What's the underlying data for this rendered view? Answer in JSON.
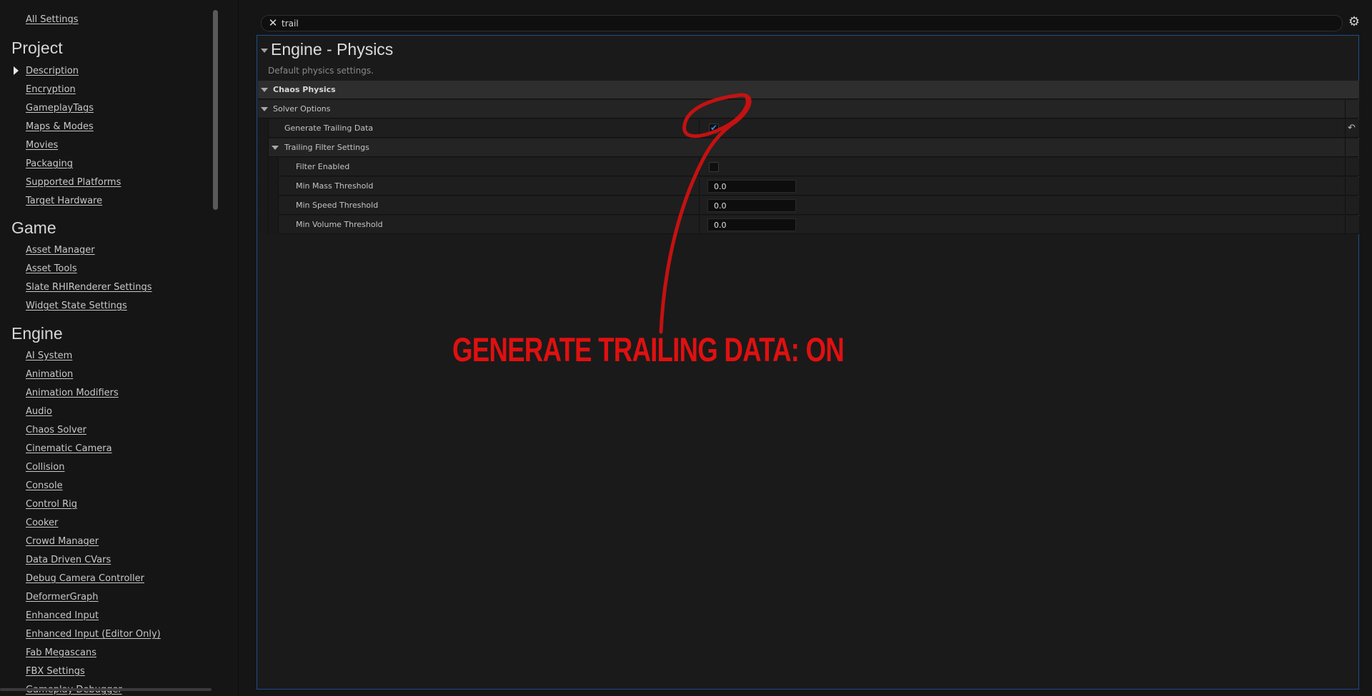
{
  "sidebar": {
    "all_settings": "All Settings",
    "sections": [
      {
        "heading": "Project",
        "items": [
          "Description",
          "Encryption",
          "GameplayTags",
          "Maps & Modes",
          "Movies",
          "Packaging",
          "Supported Platforms",
          "Target Hardware"
        ]
      },
      {
        "heading": "Game",
        "items": [
          "Asset Manager",
          "Asset Tools",
          "Slate RHIRenderer Settings",
          "Widget State Settings"
        ]
      },
      {
        "heading": "Engine",
        "items": [
          "AI System",
          "Animation",
          "Animation Modifiers",
          "Audio",
          "Chaos Solver",
          "Cinematic Camera",
          "Collision",
          "Console",
          "Control Rig",
          "Cooker",
          "Crowd Manager",
          "Data Driven CVars",
          "Debug Camera Controller",
          "DeformerGraph",
          "Enhanced Input",
          "Enhanced Input (Editor Only)",
          "Fab Megascans",
          "FBX Settings",
          "Gameplay Debugger"
        ]
      }
    ]
  },
  "search": {
    "value": "trail",
    "clear_icon": "close-icon"
  },
  "settings_icon": "gear-icon",
  "panel": {
    "title": "Engine - Physics",
    "description": "Default physics settings.",
    "category": "Chaos Physics",
    "subcategory": "Solver Options",
    "generate_trailing_data": {
      "label": "Generate Trailing Data",
      "checked": true
    },
    "trailing_filter_group": "Trailing Filter Settings",
    "filter_enabled": {
      "label": "Filter Enabled",
      "checked": false
    },
    "min_mass": {
      "label": "Min Mass Threshold",
      "value": "0.0"
    },
    "min_speed": {
      "label": "Min Speed Threshold",
      "value": "0.0"
    },
    "min_volume": {
      "label": "Min Volume Threshold",
      "value": "0.0"
    }
  },
  "annotation": {
    "text": "GENERATE TRAILING DATA: ON",
    "color": "#e01010"
  },
  "colors": {
    "panel_border": "#1e4f86",
    "checkbox_check": "#2f8de4"
  }
}
